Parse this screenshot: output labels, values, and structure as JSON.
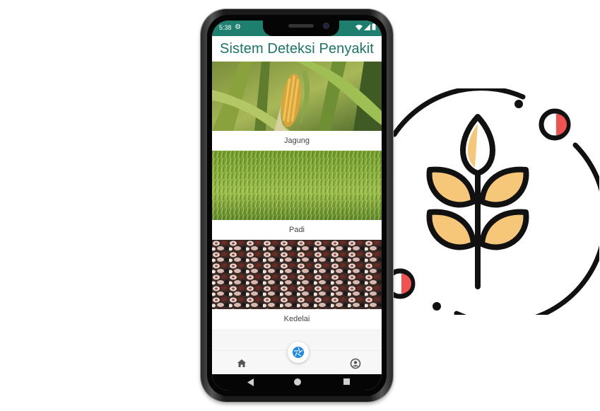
{
  "status_bar": {
    "time": "5:38",
    "icons": [
      "gear-icon",
      "wifi-icon",
      "signal-icon",
      "battery-icon"
    ]
  },
  "app_bar": {
    "title": "Sistem Deteksi Penyakit"
  },
  "crops": [
    {
      "label": "Jagung",
      "image": "corn-plant-photo"
    },
    {
      "label": "Padi",
      "image": "rice-field-photo"
    },
    {
      "label": "Kedelai",
      "image": "beans-photo"
    }
  ],
  "bottom_nav": {
    "items": [
      "home-icon",
      "camera-shutter-icon",
      "profile-icon"
    ]
  },
  "system_nav": {
    "items": [
      "back-triangle",
      "home-circle",
      "recent-square"
    ]
  },
  "colors": {
    "primary": "#1f7f6e",
    "title": "#1b7565",
    "fab_icon": "#1e88e5",
    "logo_fill": "#f6c779",
    "logo_dot": "#ef5350"
  }
}
